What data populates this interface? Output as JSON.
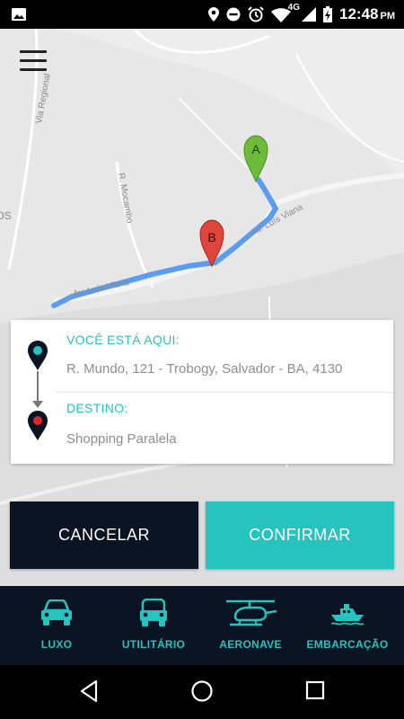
{
  "status_bar": {
    "network": "4G",
    "time": "12:48",
    "ampm": "PM"
  },
  "map": {
    "marker_a_label": "A",
    "marker_b_label": "B",
    "street_labels": [
      "Via Regional",
      "R. Mocambo",
      "Av. Luís Viana",
      "Av. Luís Viana",
      "os"
    ],
    "route_color": "#5b9cf0",
    "marker_a_color": "#6dbb3a",
    "marker_b_color": "#e0453a"
  },
  "trip_card": {
    "origin_label": "VOCÊ ESTÁ AQUI:",
    "origin_value": "R. Mundo, 121 - Trobogy, Salvador - BA, 4130",
    "destination_label": "DESTINO:",
    "destination_value": "Shopping Paralela"
  },
  "actions": {
    "cancel_label": "CANCELAR",
    "confirm_label": "CONFIRMAR"
  },
  "vehicle_nav": [
    {
      "label": "LUXO",
      "icon": "car-front-icon"
    },
    {
      "label": "UTILITÁRIO",
      "icon": "suv-front-icon"
    },
    {
      "label": "AERONAVE",
      "icon": "helicopter-icon"
    },
    {
      "label": "EMBARCAÇÃO",
      "icon": "boat-icon"
    }
  ],
  "colors": {
    "accent": "#27c3bf",
    "dark": "#0b1423"
  }
}
